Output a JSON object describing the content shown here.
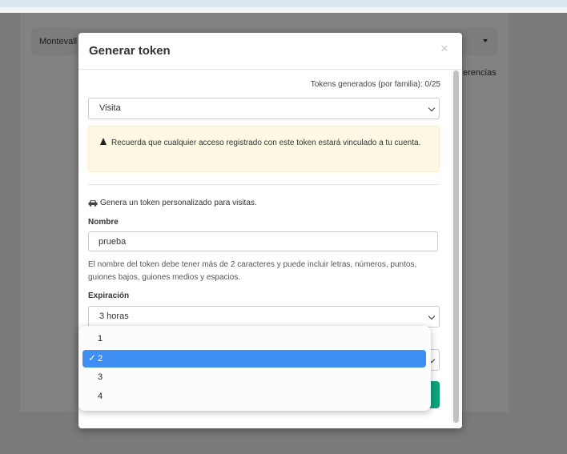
{
  "background": {
    "select_text": "Montevall",
    "preferences_text": "erencias"
  },
  "modal": {
    "title": "Generar token",
    "close_icon": "×",
    "tokens_count": "Tokens generados (por familia): 0/25",
    "type_select": "Visita",
    "alert_text": "Recuerda que cualquier acceso registrado con este token estará vinculado a tu cuenta.",
    "generate_text": "Genera un token personalizado para visitas.",
    "name_label": "Nombre",
    "name_value": "prueba",
    "name_help": "El nombre del token debe tener más de 2 caracteres y puede incluir letras, números, puntos, guiones bajos, guiones medios y espacios.",
    "expiration_label": "Expiración",
    "expiration_value": "3 horas"
  },
  "dropdown": {
    "options": [
      "1",
      "2",
      "3",
      "4"
    ],
    "selected": "2",
    "check": "✓"
  },
  "colors": {
    "accent": "#3d8ff4",
    "alert_bg": "#fcf8e3",
    "overlay": "#7a7a7a"
  },
  "icons": [
    "warning-icon",
    "car-icon",
    "chevron-down-icon",
    "check-icon",
    "close-icon"
  ]
}
